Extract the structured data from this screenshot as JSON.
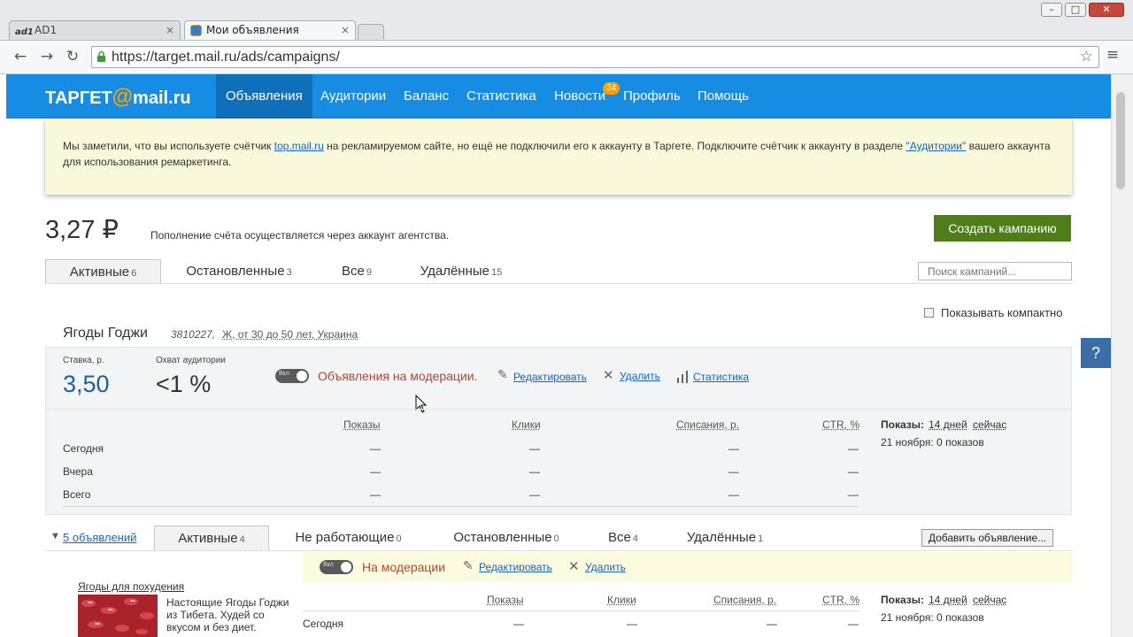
{
  "browser": {
    "tabs": [
      {
        "label": "AD1",
        "prefix": "ad1"
      },
      {
        "label": "Мои объявления"
      }
    ],
    "tab_close": "×",
    "url": "https://target.mail.ru/ads/campaigns/",
    "win_min": "–",
    "win_max": "□",
    "win_close": "✕"
  },
  "site": {
    "logo_left": "ТАРГЕТ",
    "logo_at": "@",
    "logo_right": "mail.ru",
    "nav": [
      "Объявления",
      "Аудитории",
      "Баланс",
      "Статистика",
      "Новости",
      "Профиль",
      "Помощь"
    ],
    "news_badge": "24"
  },
  "notice": {
    "text_1": "Мы заметили, что вы используете счётчик ",
    "link_1": "top.mail.ru",
    "text_2": " на рекламируемом сайте, но ещё не подключили его к аккаунту в Таргете. Подключите счётчик к аккаунту в разделе ",
    "link_2": "\"Аудитории\"",
    "text_3": " вашего аккаунта для использования ремаркетинга."
  },
  "balance": {
    "amount": "3,27 ₽",
    "note": "Пополнение счёта осуществляется через аккаунт агентства."
  },
  "create_button": "Создать кампанию",
  "campaign_tabs": [
    {
      "label": "Активные",
      "count": "6"
    },
    {
      "label": "Остановленные",
      "count": "3"
    },
    {
      "label": "Все",
      "count": "9"
    },
    {
      "label": "Удалённые",
      "count": "15"
    }
  ],
  "search_placeholder": "Поиск кампаний...",
  "compact_label": "Показывать компактно",
  "campaign": {
    "name": "Ягоды Годжи",
    "id": "3810227,",
    "targeting": "Ж, от 30 до 50 лет, Украина",
    "rate_label": "Ставка, р.",
    "rate": "3,50",
    "reach_label": "Охват аудитории",
    "reach": "<1 %",
    "toggle_label": "Вкл",
    "status": "Объявления на модерации.",
    "edit": "Редактировать",
    "delete": "Удалить",
    "stats": "Статистика",
    "table": {
      "headers": [
        "Показы",
        "Клики",
        "Списания, р.",
        "CTR, %"
      ],
      "rows": [
        {
          "label": "Сегодня",
          "values": [
            "—",
            "—",
            "—",
            "—"
          ]
        },
        {
          "label": "Вчера",
          "values": [
            "—",
            "—",
            "—",
            "—"
          ]
        },
        {
          "label": "Всего",
          "values": [
            "—",
            "—",
            "—",
            "—"
          ]
        }
      ],
      "side_label": "Показы:",
      "side_period": "14 дней",
      "side_now": "сейчас",
      "side_date": "21 ноября: 0 показов"
    }
  },
  "ads": {
    "toggle_label": "5 объявлений",
    "tabs": [
      {
        "label": "Активные",
        "count": "4"
      },
      {
        "label": "Не работающие",
        "count": "0"
      },
      {
        "label": "Остановленные",
        "count": "0"
      },
      {
        "label": "Все",
        "count": "4"
      },
      {
        "label": "Удалённые",
        "count": "1"
      }
    ],
    "add_button": "Добавить объявление...",
    "band_status": "На модерации",
    "band_edit": "Редактировать",
    "band_delete": "Удалить",
    "ad": {
      "title": "Ягоды для похудения",
      "text": "Настоящие Ягоды Годжи из Тибета. Худей со вкусом и без диет.",
      "headers": [
        "Показы",
        "Клики",
        "Списания, р.",
        "CTR, %"
      ],
      "row_label": "Сегодня",
      "row_values": [
        "—",
        "—",
        "—",
        "—"
      ],
      "side_label": "Показы:",
      "side_period": "14 дней",
      "side_now": "сейчас",
      "side_date": "21 ноября: 0 показов"
    }
  },
  "help": "?"
}
